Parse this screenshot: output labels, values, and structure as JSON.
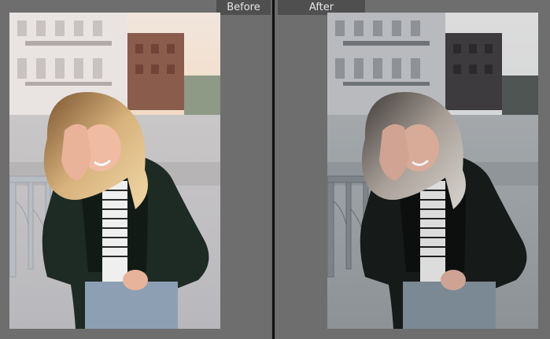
{
  "view": {
    "before_label": "Before",
    "after_label": "After"
  },
  "photos": {
    "before": {
      "subject": "woman-in-leather-jacket",
      "tone": "warm-original"
    },
    "after": {
      "subject": "woman-in-leather-jacket",
      "tone": "cool-muted-edit"
    }
  },
  "colors": {
    "panel_bg": "#6e6e6e",
    "tab_bg": "#4f4f4f",
    "tab_text": "#e6e6e6",
    "divider": "#111111"
  }
}
